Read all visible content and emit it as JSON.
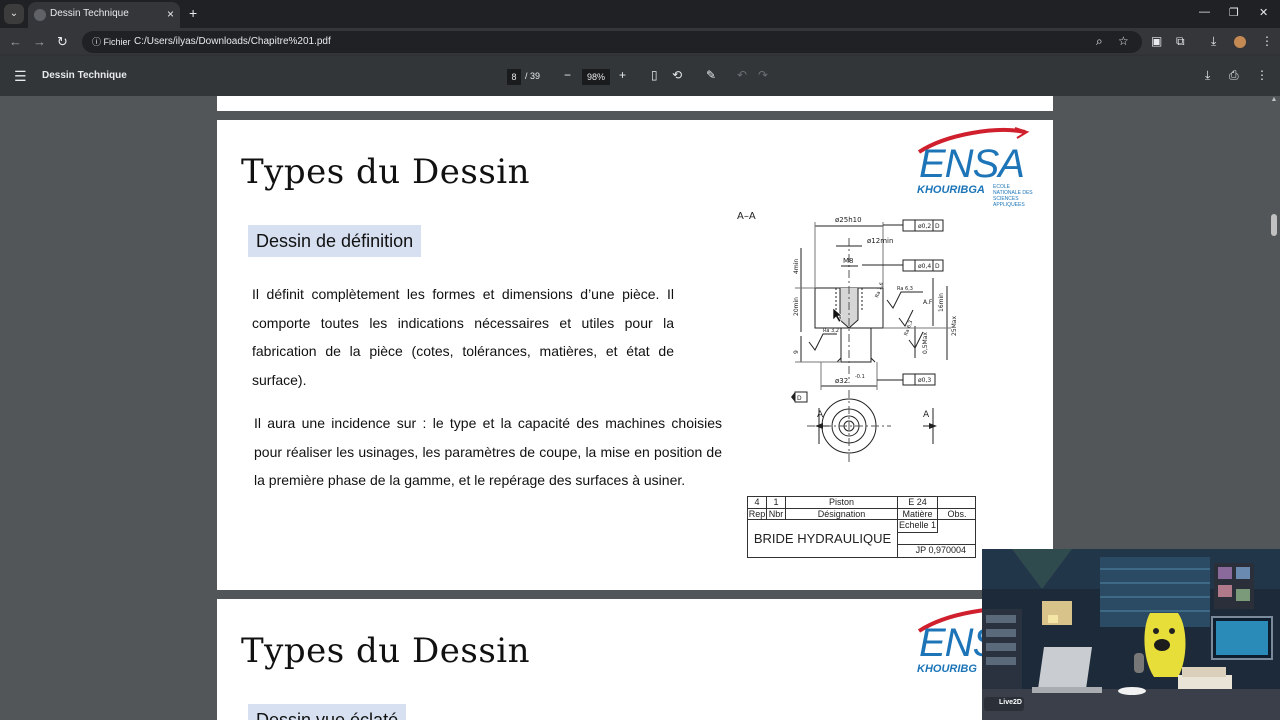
{
  "browser": {
    "tab_title": "Dessin Technique",
    "new_tab_glyph": "+",
    "url_chip": "Fichier",
    "url": "C:/Users/ilyas/Downloads/Chapitre%201.pdf",
    "icons": [
      "chevron-down-icon",
      "close-icon",
      "back-icon",
      "forward-icon",
      "reload-icon",
      "info-icon",
      "zoom-icon",
      "star-icon",
      "extensions-icon",
      "download-icon",
      "profile-icon",
      "menu-icon"
    ]
  },
  "pdf_toolbar": {
    "title": "Dessin Technique",
    "current_page": "8",
    "total_pages": "/ 39",
    "zoom": "98%"
  },
  "page1": {
    "title": "Types du Dessin",
    "logo_text": "ENSA",
    "logo_subtitle": "KHOURIBGA",
    "logo_small": "ECOLE NATIONALE DES SCIENCES APPLIQUEES",
    "section_heading": "Dessin de définition",
    "paragraph1": "Il définit complètement les formes et dimensions d’une pièce. Il comporte toutes les indications nécessaires et utiles pour la fabrication de la pièce (cotes, tolérances, matières, et état de surface).",
    "paragraph2": "Il aura une incidence sur : le type et la capacité des machines choisies pour réaliser les usinages, les paramètres de coupe, la mise en position de la première phase de la gamme, et le repérage des surfaces à usiner.",
    "drawing": {
      "section_label": "A–A",
      "cut_label_left": "A",
      "cut_label_right": "A",
      "dims": {
        "d25": "ø25h10",
        "d12": "ø12min",
        "m8": "M8",
        "d32": "ø32",
        "d32_tol": "-0.1",
        "gdt1": "ø0,2",
        "gdt1_ref": "D",
        "gdt2": "ø0,4",
        "gdt2_ref": "D",
        "gdt3": "ø0,3",
        "datum": "D",
        "v4": "4min",
        "v20": "20min",
        "v16": "16min",
        "v05": "0,5Max",
        "v25": "25Max",
        "v9": "9",
        "ra1": "Ra 6,3",
        "ra2": "Ra 1,6",
        "ra3": "Ra 3,2",
        "ra4": "Ra 6,3",
        "af": "A.F"
      }
    },
    "cartouche": {
      "row1": [
        "4",
        "1",
        "Piston",
        "E 24",
        ""
      ],
      "row2": [
        "Rep",
        "Nbr",
        "Désignation",
        "Matière",
        "Obs."
      ],
      "title": "BRIDE HYDRAULIQUE",
      "scale": "Echelle 1",
      "ref": "JP 0,970004"
    }
  },
  "page2": {
    "title": "Types du Dessin",
    "logo_text": "ENS",
    "logo_subtitle": "KHOURIBG",
    "section_heading": "Dessin vue éclaté"
  },
  "overlay": {
    "badge": "Live2D"
  }
}
